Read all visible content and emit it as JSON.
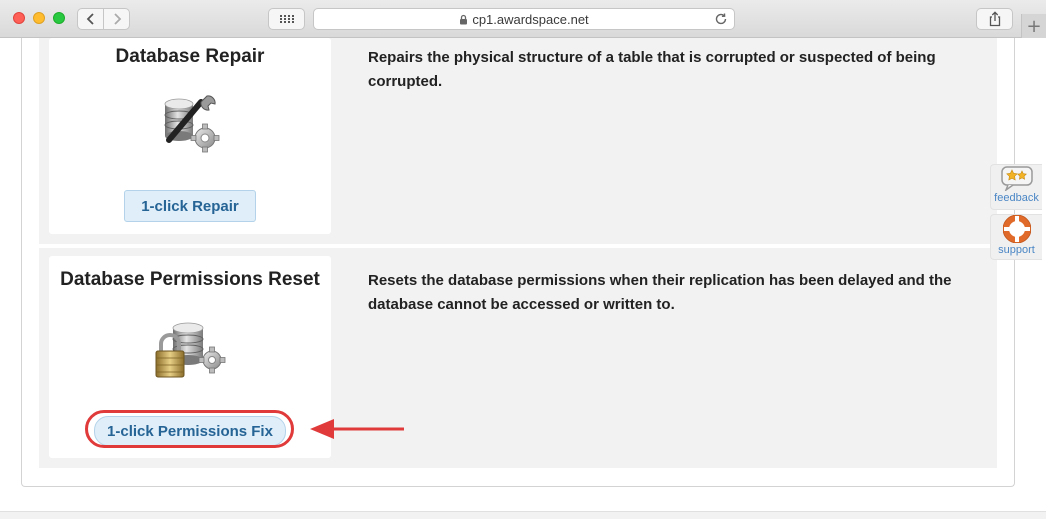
{
  "browser": {
    "url": "cp1.awardspace.net"
  },
  "tools": [
    {
      "title": "Database Repair",
      "icon": "database-wrench-icon",
      "button_label": "1-click Repair",
      "description": "Repairs the physical structure of a table that is corrupted or suspected of being corrupted."
    },
    {
      "title": "Database Permissions Reset",
      "icon": "database-lock-icon",
      "button_label": "1-click Permissions Fix",
      "description": "Resets the database permissions when their replication has been delayed and the database cannot be accessed or written to."
    }
  ],
  "side_tabs": {
    "feedback_label": "feedback",
    "support_label": "support"
  },
  "colors": {
    "accent_button_text": "#266496",
    "button_bg": "#dfeef8",
    "annotation_red": "#e03a3a",
    "section_bg": "#f2f2f2"
  }
}
